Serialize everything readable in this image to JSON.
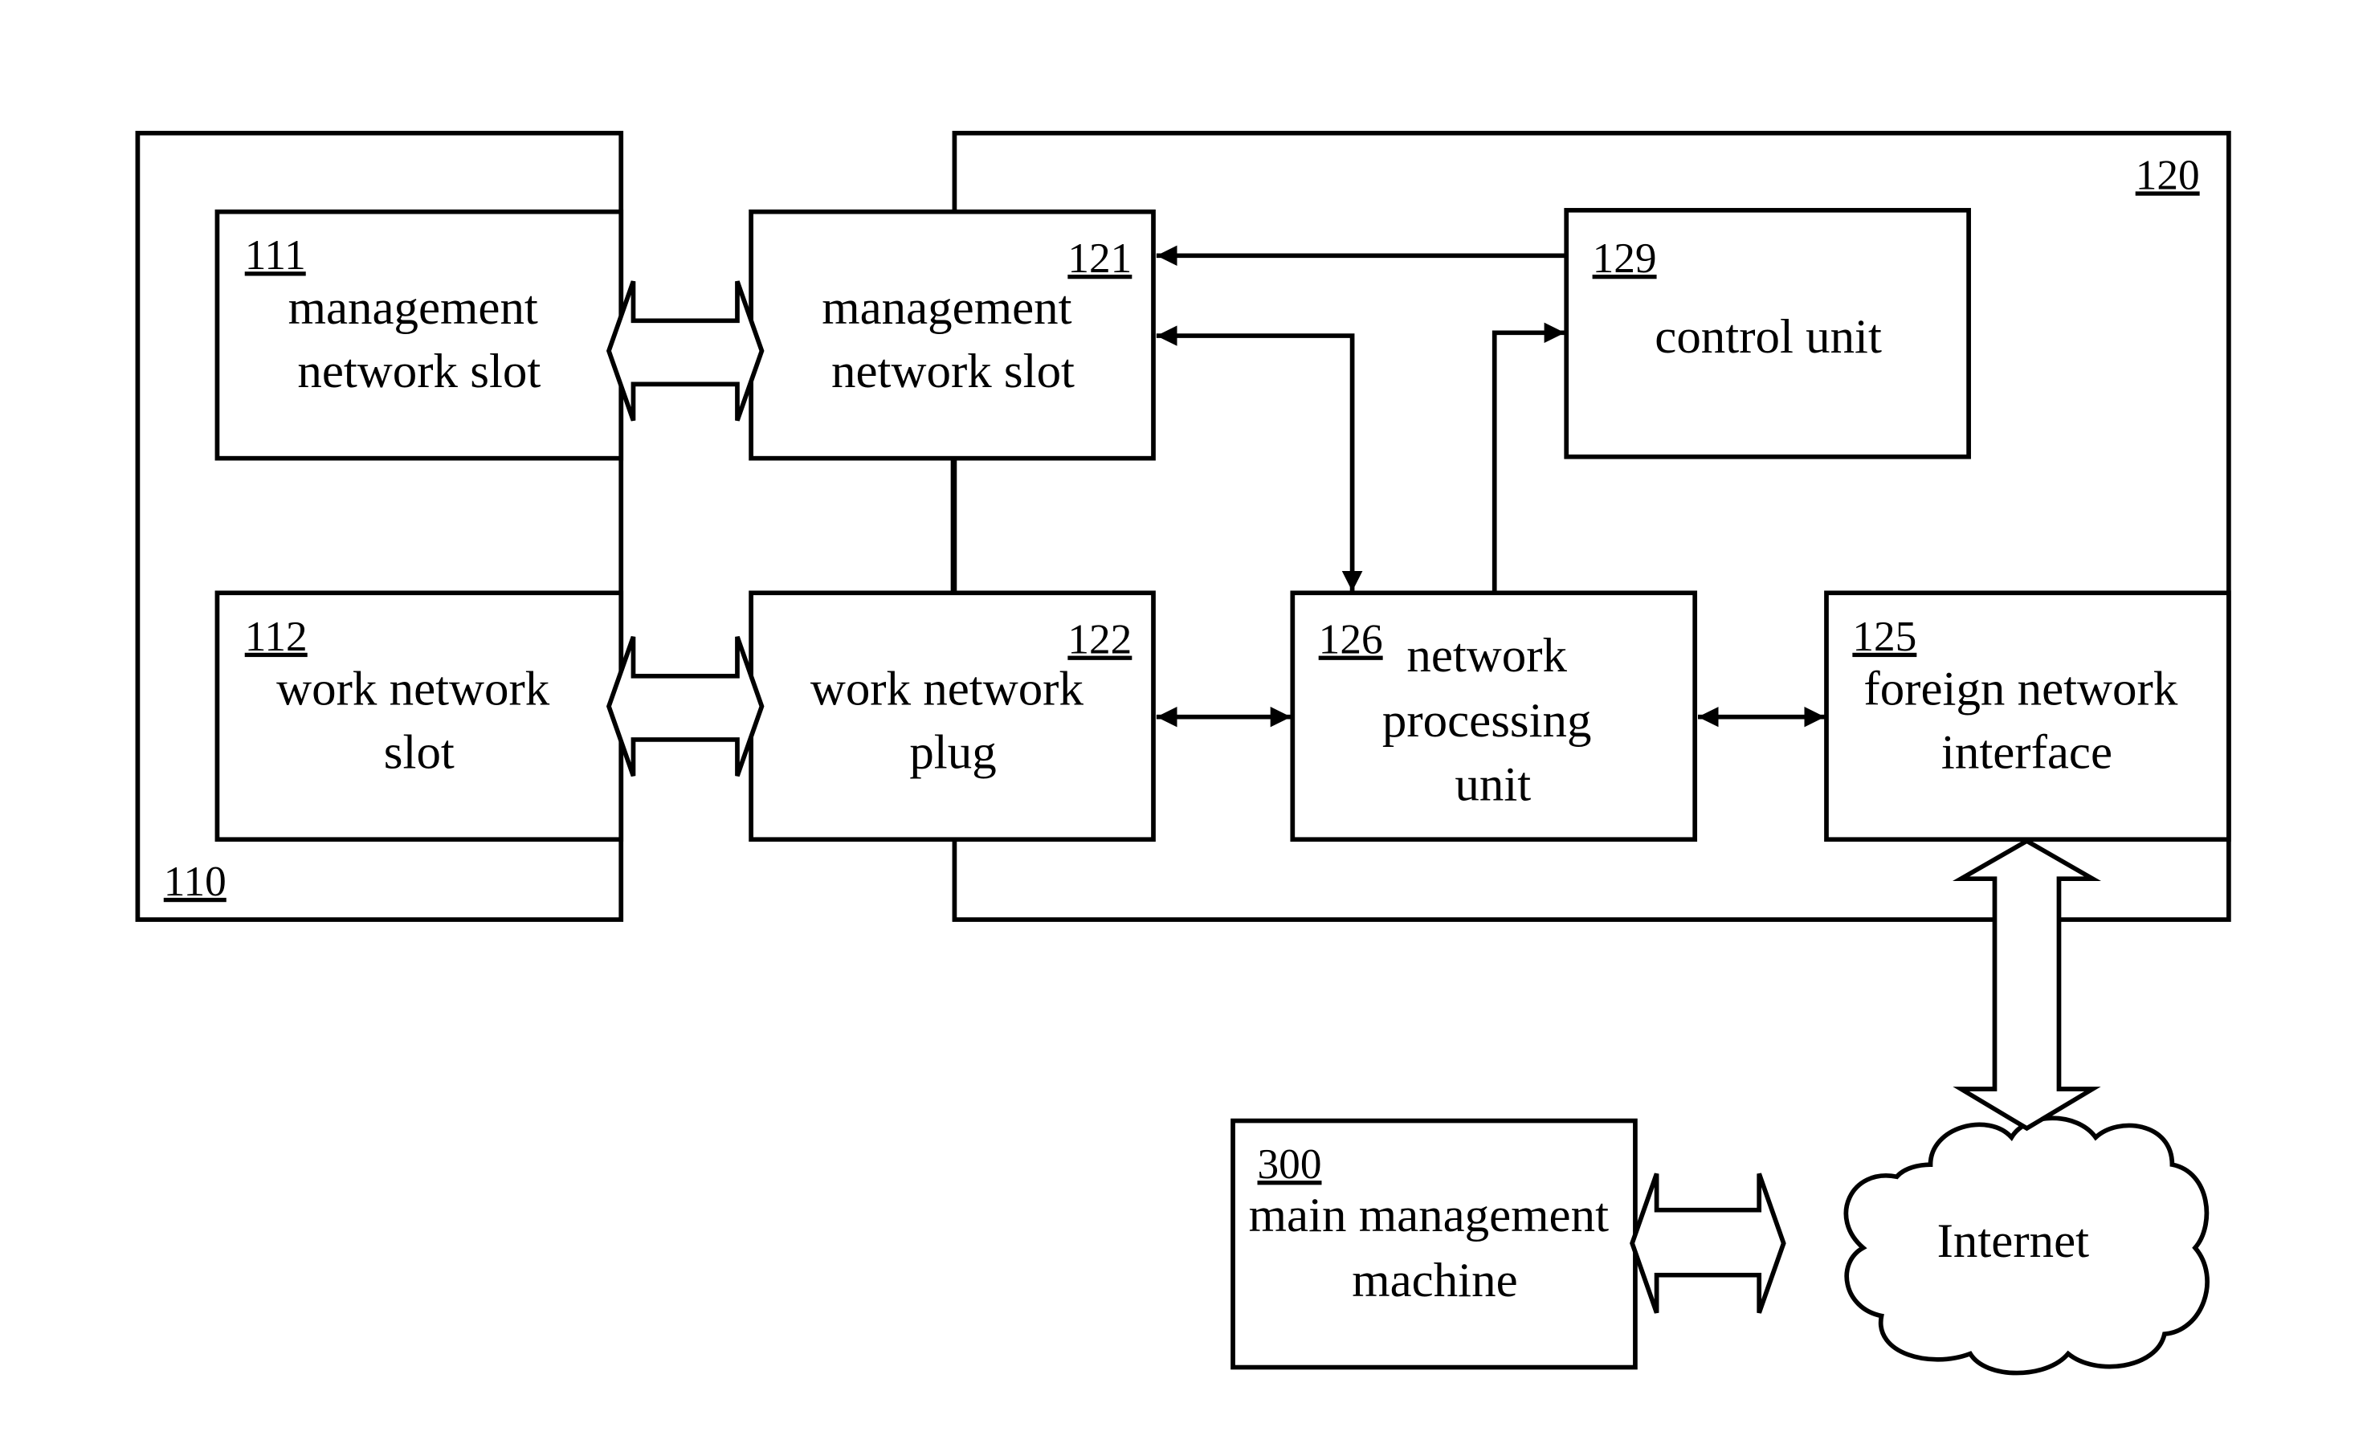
{
  "diagram": {
    "blocks": {
      "b110": {
        "ref": "110"
      },
      "b120": {
        "ref": "120"
      },
      "b111": {
        "ref": "111",
        "line1": "management",
        "line2": "network slot"
      },
      "b112": {
        "ref": "112",
        "line1": "work network",
        "line2": "slot"
      },
      "b121": {
        "ref": "121",
        "line1": "management",
        "line2": "network slot"
      },
      "b122": {
        "ref": "122",
        "line1": "work network",
        "line2": "plug"
      },
      "b126": {
        "ref": "126",
        "line1": "network",
        "line2": "processing",
        "line3": "unit"
      },
      "b125": {
        "ref": "125",
        "line1": "foreign network",
        "line2": "interface"
      },
      "b129": {
        "ref": "129",
        "line1": "control unit"
      },
      "b300": {
        "ref": "300",
        "line1": "main management",
        "line2": "machine"
      },
      "internet": {
        "label": "Internet"
      }
    },
    "connections": [
      {
        "from": "111",
        "to": "121",
        "type": "bidirectional-bus"
      },
      {
        "from": "112",
        "to": "122",
        "type": "bidirectional-bus"
      },
      {
        "from": "129",
        "to": "121",
        "type": "arrow"
      },
      {
        "from": "121",
        "to": "126",
        "type": "bidirectional-arrow"
      },
      {
        "from": "126",
        "to": "129",
        "type": "arrow"
      },
      {
        "from": "122",
        "to": "126",
        "type": "bidirectional-arrow"
      },
      {
        "from": "126",
        "to": "125",
        "type": "bidirectional-arrow"
      },
      {
        "from": "125",
        "to": "internet",
        "type": "bidirectional-bus"
      },
      {
        "from": "300",
        "to": "internet",
        "type": "bidirectional-bus"
      }
    ]
  }
}
